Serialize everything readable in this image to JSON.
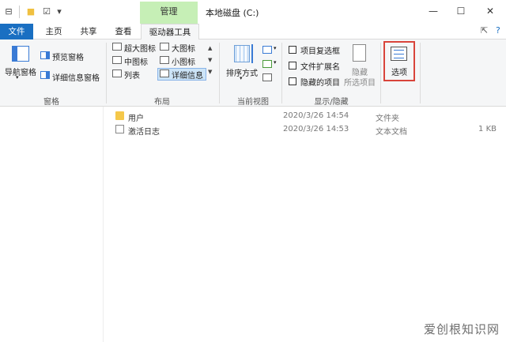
{
  "window": {
    "context_tab": "管理",
    "title": "本地磁盘 (C:)",
    "controls": {
      "minimize": "—",
      "maximize": "☐",
      "close": "✕"
    }
  },
  "quick_access": {
    "down_icon": "▾"
  },
  "menu": {
    "file": "文件",
    "home": "主页",
    "share": "共享",
    "view": "查看",
    "drive_tools": "驱动器工具",
    "pin_icon": "⇱",
    "help_icon": "?"
  },
  "ribbon": {
    "panes": {
      "label": "窗格",
      "nav_pane": "导航窗格",
      "preview_pane": "预览窗格",
      "details_pane": "详细信息窗格"
    },
    "layout": {
      "label": "布局",
      "items": [
        "超大图标",
        "大图标",
        "中图标",
        "小图标",
        "列表",
        "详细信息"
      ]
    },
    "current_view": {
      "label": "当前视图",
      "sort_by": "排序方式"
    },
    "show_hide": {
      "label": "显示/隐藏",
      "item_checkboxes": "项目复选框",
      "file_extensions": "文件扩展名",
      "hidden_items": "隐藏的项目",
      "hide_selected_1": "隐藏",
      "hide_selected_2": "所选项目"
    },
    "options": "选项"
  },
  "files": [
    {
      "name": "用户",
      "date": "2020/3/26 14:54",
      "type": "文件夹",
      "size": "",
      "kind": "folder"
    },
    {
      "name": "激活日志",
      "date": "2020/3/26 14:53",
      "type": "文本文档",
      "size": "1 KB",
      "kind": "file"
    }
  ],
  "watermark": "爱创根知识网"
}
